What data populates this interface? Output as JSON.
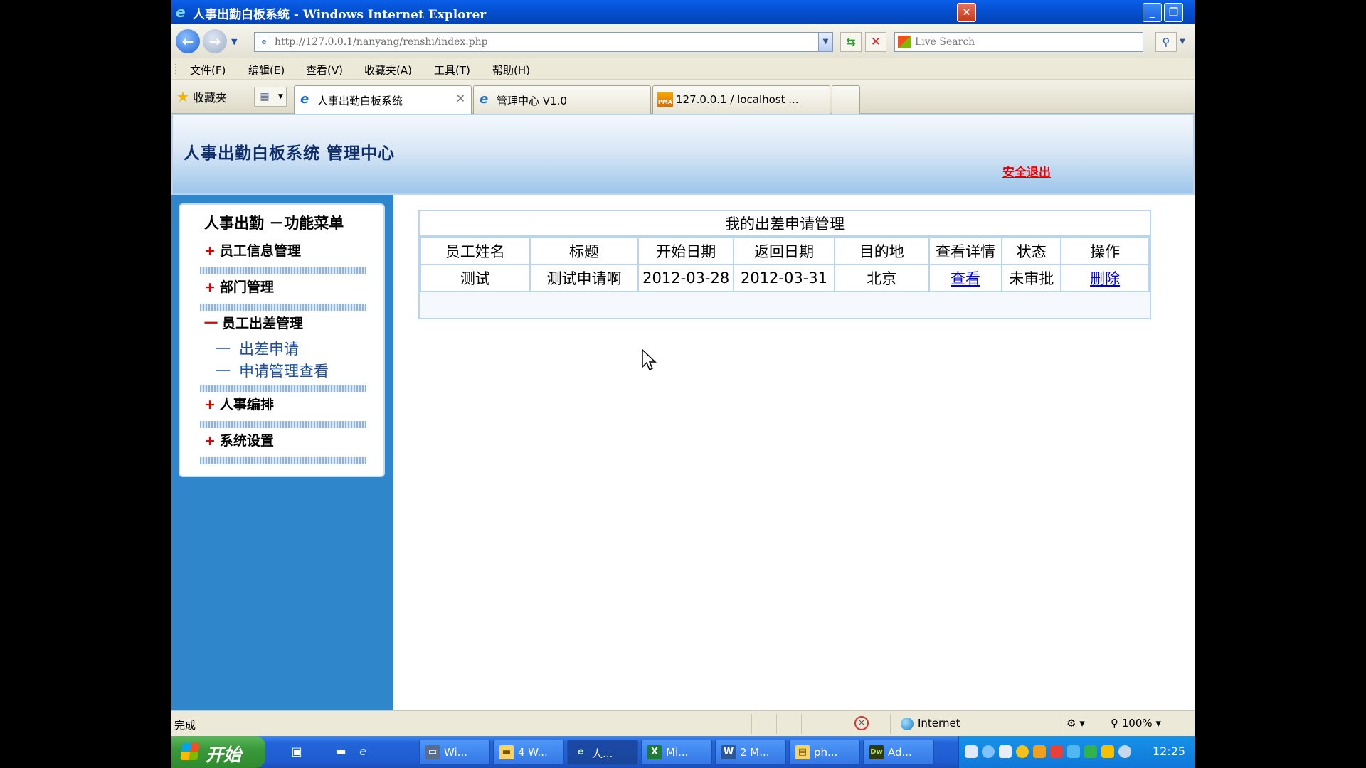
{
  "window": {
    "title": "人事出勤白板系统 - Windows Internet Explorer",
    "buttons": [
      "minimize",
      "restore",
      "close"
    ]
  },
  "toolbar": {
    "address_url": "http://127.0.0.1/nanyang/renshi/index.php",
    "search_placeholder": "Live Search"
  },
  "menu": {
    "items": [
      "文件(F)",
      "编辑(E)",
      "查看(V)",
      "收藏夹(A)",
      "工具(T)",
      "帮助(H)"
    ]
  },
  "tabs": {
    "favorites_label": "收藏夹",
    "items": [
      {
        "label": "人事出勤白板系统",
        "active": true
      },
      {
        "label": "管理中心 V1.0",
        "active": false
      },
      {
        "label": "127.0.0.1 / localhost ...",
        "active": false
      }
    ]
  },
  "header": {
    "site_title": "人事出勤白板系统 管理中心",
    "logout": "安全退出"
  },
  "sidebar": {
    "title": "人事出勤 －功能菜单",
    "groups": [
      {
        "label": "员工信息管理",
        "expanded": false
      },
      {
        "label": "部门管理",
        "expanded": false
      },
      {
        "label": "员工出差管理",
        "expanded": true,
        "children": [
          "出差申请",
          "申请管理查看"
        ]
      },
      {
        "label": "人事编排",
        "expanded": false
      },
      {
        "label": "系统设置",
        "expanded": false
      }
    ],
    "plus_symbol": "+",
    "minus_symbol": "一",
    "sub_dash": "一"
  },
  "main": {
    "panel_title": "我的出差申请管理",
    "columns": [
      "员工姓名",
      "标题",
      "开始日期",
      "返回日期",
      "目的地",
      "查看详情",
      "状态",
      "操作"
    ],
    "rows": [
      {
        "name": "测试",
        "title": "测试申请啊",
        "start": "2012-03-28",
        "end": "2012-03-31",
        "destination": "北京",
        "view": "查看",
        "status": "未审批",
        "action": "删除"
      }
    ]
  },
  "statusbar": {
    "text": "完成",
    "zone": "Internet",
    "zoom": "100%"
  },
  "taskbar": {
    "start": "开始",
    "tasks": [
      {
        "label": "Wi...",
        "icon": "monitor-icon"
      },
      {
        "label": "4 W...",
        "icon": "folder-icon"
      },
      {
        "label": "人...",
        "icon": "ie-icon",
        "active": true
      },
      {
        "label": "Mi...",
        "icon": "excel-icon"
      },
      {
        "label": "2 M...",
        "icon": "word-icon"
      },
      {
        "label": "ph...",
        "icon": "notepad-icon"
      },
      {
        "label": "Ad...",
        "icon": "dreamweaver-icon"
      }
    ],
    "clock": "12:25"
  },
  "colors": {
    "accent_blue": "#2f86cb",
    "title_blue": "#0551d3",
    "alert_red": "#e00000",
    "link_blue": "#0000ee",
    "table_border": "#b9d4ee"
  }
}
